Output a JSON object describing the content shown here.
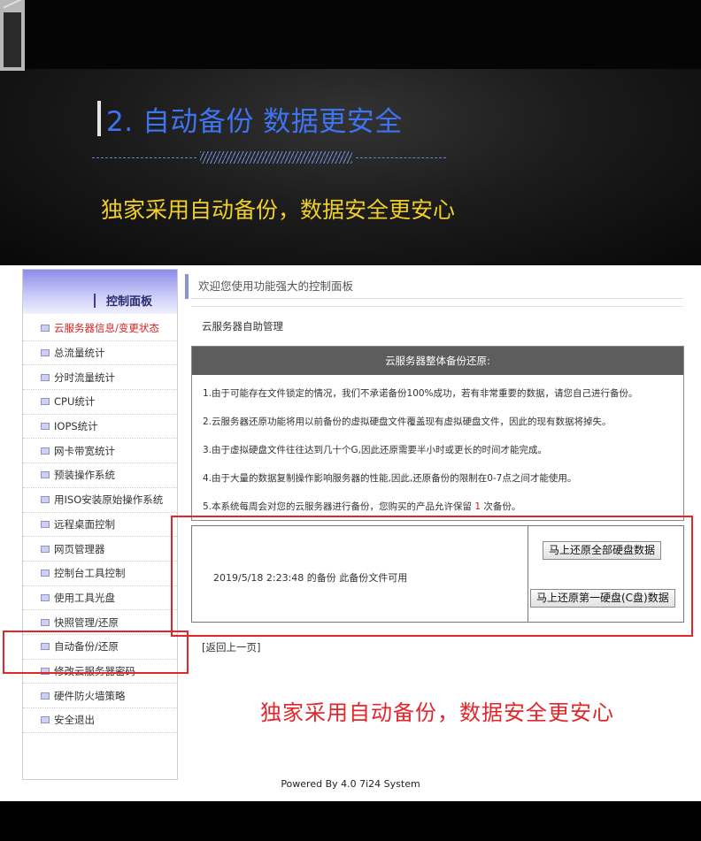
{
  "banner": {
    "title": "2. 自动备份  数据更安全",
    "subtitle": "独家采用自动备份，数据安全更安心"
  },
  "sidebar": {
    "title": "控制面板",
    "items": [
      {
        "label": "云服务器信息/变更状态",
        "active": true
      },
      {
        "label": "总流量统计"
      },
      {
        "label": "分时流量统计"
      },
      {
        "label": "CPU统计"
      },
      {
        "label": "IOPS统计"
      },
      {
        "label": "网卡带宽统计"
      },
      {
        "label": "预装操作系统"
      },
      {
        "label": "用ISO安装原始操作系统"
      },
      {
        "label": "远程桌面控制"
      },
      {
        "label": "网页管理器"
      },
      {
        "label": "控制台工具控制"
      },
      {
        "label": "使用工具光盘"
      },
      {
        "label": "快照管理/还原"
      },
      {
        "label": "自动备份/还原"
      },
      {
        "label": "修改云服务器密码"
      },
      {
        "label": "硬件防火墙策略"
      },
      {
        "label": "安全退出"
      }
    ]
  },
  "content": {
    "header": "欢迎您使用功能强大的控制面板",
    "section_title": "云服务器自助管理",
    "notice": {
      "title": "云服务器整体备份还原:",
      "items": [
        "1.由于可能存在文件锁定的情况，我们不承诺备份100%成功，若有非常重要的数据，请您自己进行备份。",
        "2.云服务器还原功能将用以前备份的虚拟硬盘文件覆盖现有虚拟硬盘文件，因此的现有数据将掉失。",
        "3.由于虚拟硬盘文件往往达到几十个G,因此还原需要半小时或更长的时间才能完成。",
        "4.由于大量的数据复制操作影响服务器的性能,因此,还原备份的限制在0-7点之间才能使用。"
      ],
      "item5_prefix": "5.本系统每周会对您的云服务器进行备份，您购买的产品允许保留",
      "item5_count": "1",
      "item5_suffix": "次备份。"
    },
    "backup": {
      "info": "2019/5/18 2:23:48 的备份    此备份文件可用",
      "restore_all_label": "马上还原全部硬盘数据",
      "restore_first_label": "马上还原第一硬盘(C盘)数据"
    },
    "back_link": "[返回上一页]",
    "slogan": "独家采用自动备份，数据安全更安心",
    "footer": "Powered By 4.0 7i24 System"
  },
  "colors": {
    "highlight": "#e3262b",
    "banner_title": "#3e74f0",
    "banner_subtitle": "#f1cf2b"
  }
}
